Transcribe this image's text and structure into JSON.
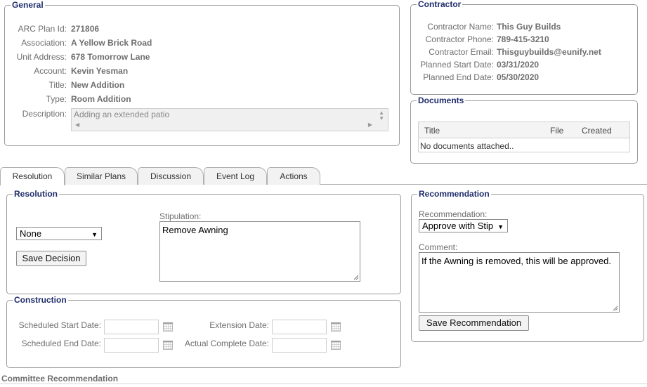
{
  "general": {
    "legend": "General",
    "fields": [
      {
        "label": "ARC Plan Id:",
        "value": "271806"
      },
      {
        "label": "Association:",
        "value": "A Yellow Brick Road"
      },
      {
        "label": "Unit Address:",
        "value": "678 Tomorrow Lane"
      },
      {
        "label": "Account:",
        "value": "Kevin Yesman"
      },
      {
        "label": "Title:",
        "value": "New Addition"
      },
      {
        "label": "Type:",
        "value": "Room Addition"
      }
    ],
    "description_label": "Description:",
    "description_value": "Adding an extended patio"
  },
  "contractor": {
    "legend": "Contractor",
    "fields": [
      {
        "label": "Contractor Name:",
        "value": "This Guy Builds"
      },
      {
        "label": "Contractor Phone:",
        "value": "789-415-3210"
      },
      {
        "label": "Contractor Email:",
        "value": "Thisguybuilds@eunify.net"
      },
      {
        "label": "Planned Start Date:",
        "value": "03/31/2020"
      },
      {
        "label": "Planned End Date:",
        "value": "05/30/2020"
      }
    ]
  },
  "documents": {
    "legend": "Documents",
    "columns": [
      "Title",
      "File",
      "Created"
    ],
    "empty_text": "No documents attached.."
  },
  "tabs": [
    {
      "label": "Resolution",
      "active": true
    },
    {
      "label": "Similar Plans",
      "active": false
    },
    {
      "label": "Discussion",
      "active": false
    },
    {
      "label": "Event Log",
      "active": false
    },
    {
      "label": "Actions",
      "active": false
    }
  ],
  "resolution": {
    "legend": "Resolution",
    "decision_value": "None",
    "save_button": "Save Decision",
    "stipulation_label": "Stipulation:",
    "stipulation_value": "Remove Awning"
  },
  "construction": {
    "legend": "Construction",
    "scheduled_start_label": "Scheduled Start Date:",
    "scheduled_end_label": "Scheduled End Date:",
    "extension_label": "Extension Date:",
    "actual_complete_label": "Actual Complete Date:"
  },
  "recommendation": {
    "legend": "Recommendation",
    "recommendation_label": "Recommendation:",
    "recommendation_value": "Approve with Stip",
    "comment_label": "Comment:",
    "comment_value": "If the Awning is removed, this will be approved.",
    "save_button": "Save Recommendation"
  },
  "committee": {
    "legend": "Committee Recommendation"
  }
}
